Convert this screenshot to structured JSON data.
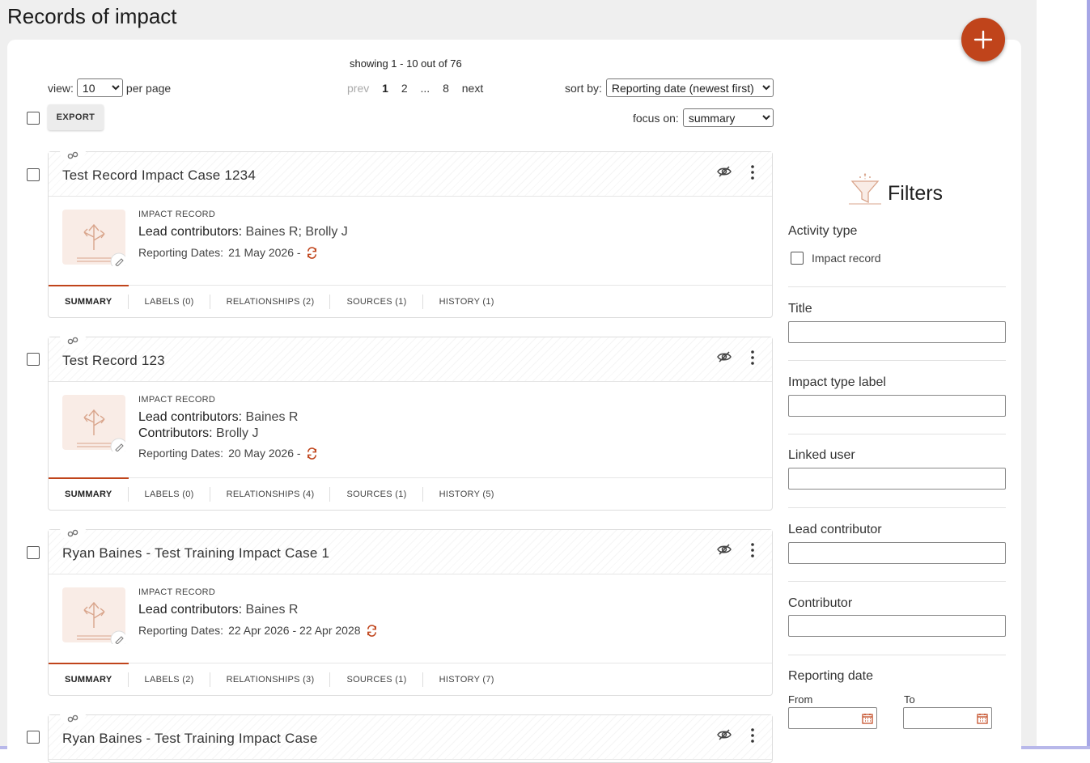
{
  "page": {
    "title": "Records of impact"
  },
  "colors": {
    "accent": "#c0441b",
    "edit_icon": "#c0441b"
  },
  "toolbar": {
    "showing_text": "showing 1 - 10 out of 76",
    "view_label": "view:",
    "per_page_value": "10",
    "per_page_label": "per page",
    "pager": {
      "prev": "prev",
      "pages": [
        "1",
        "2",
        "...",
        "8"
      ],
      "current": "1",
      "next": "next"
    },
    "sort_label": "sort by:",
    "sort_value": "Reporting date (newest first)",
    "focus_label": "focus on:",
    "focus_value": "summary",
    "export_label": "EXPORT",
    "add_icon": "plus-icon"
  },
  "records": [
    {
      "title": "Test Record Impact Case 1234",
      "type": "IMPACT RECORD",
      "lead_label": "Lead contributors",
      "lead": "Baines R; Brolly J",
      "contrib_label": "",
      "contrib": "",
      "rep_label": "Reporting Dates:",
      "rep_value": "21 May 2026 -",
      "tabs": [
        "SUMMARY",
        "LABELS (0)",
        "RELATIONSHIPS (2)",
        "SOURCES (1)",
        "HISTORY (1)"
      ]
    },
    {
      "title": "Test Record 123",
      "type": "IMPACT RECORD",
      "lead_label": "Lead contributors",
      "lead": "Baines R",
      "contrib_label": "Contributors",
      "contrib": "Brolly J",
      "rep_label": "Reporting Dates:",
      "rep_value": "20 May 2026 -",
      "tabs": [
        "SUMMARY",
        "LABELS (0)",
        "RELATIONSHIPS (4)",
        "SOURCES (1)",
        "HISTORY (5)"
      ]
    },
    {
      "title": "Ryan Baines - Test Training Impact Case 1",
      "type": "IMPACT RECORD",
      "lead_label": "Lead contributors",
      "lead": "Baines R",
      "contrib_label": "",
      "contrib": "",
      "rep_label": "Reporting Dates:",
      "rep_value": "22 Apr 2026 - 22 Apr 2028",
      "tabs": [
        "SUMMARY",
        "LABELS (2)",
        "RELATIONSHIPS (3)",
        "SOURCES (1)",
        "HISTORY (7)"
      ]
    },
    {
      "title": "Ryan Baines - Test Training Impact Case"
    }
  ],
  "filters": {
    "title": "Filters",
    "activity_type_label": "Activity type",
    "impact_record_option": "Impact record",
    "title_label": "Title",
    "impact_type_label": "Impact type label",
    "linked_user_label": "Linked user",
    "lead_contributor_label": "Lead contributor",
    "contributor_label": "Contributor",
    "reporting_date_label": "Reporting date",
    "from_label": "From",
    "to_label": "To"
  }
}
